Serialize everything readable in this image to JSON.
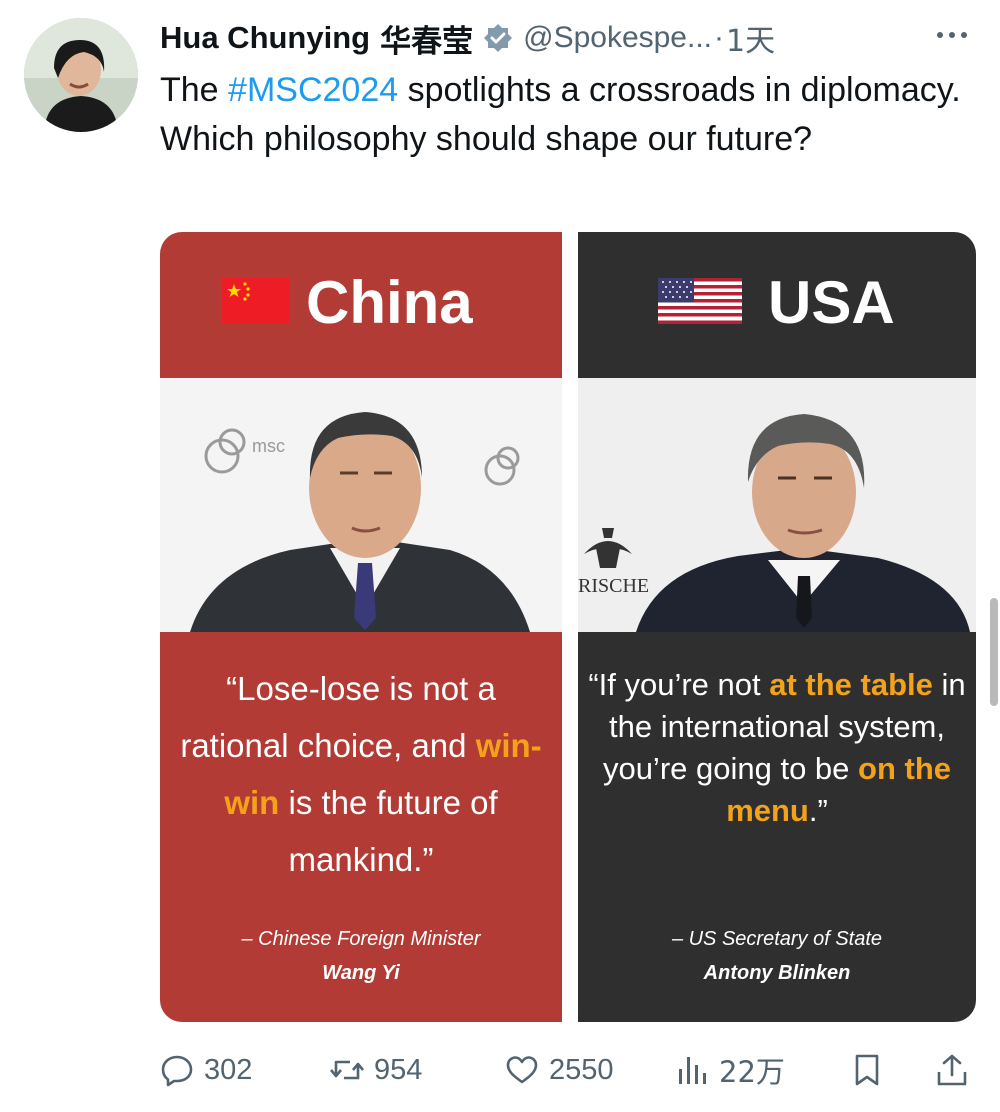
{
  "tweet": {
    "author_name": "Hua Chunying",
    "author_name_cn": "华春莹",
    "handle": "@Spokespe...",
    "separator": "·",
    "time": "1天",
    "text_before": "The ",
    "hashtag": "#MSC2024",
    "text_after": " spotlights a crossroads in diplomacy. Which philosophy should shape our future?"
  },
  "media": {
    "china": {
      "title": "China",
      "quote_open": "“Lose-lose is not a rational choice, and ",
      "quote_highlight": "win-win",
      "quote_close": " is the future of mankind.”",
      "attrib_role": "– Chinese Foreign Minister",
      "attrib_name": "Wang Yi",
      "panel_color": "#b23b35"
    },
    "usa": {
      "title": "USA",
      "quote_open": "“If you’re not ",
      "quote_highlight1": "at the table",
      "quote_mid": " in the international system, you’re going to be ",
      "quote_highlight2": "on the menu",
      "quote_close": ".”",
      "attrib_role": "– US Secretary of State",
      "attrib_name": "Antony Blinken",
      "panel_color": "#2f2f2f"
    },
    "highlight_color": "#f5a21b",
    "photo_text_china_logo": "msc",
    "photo_text_usa_sign": "RISCHE"
  },
  "actions": {
    "reply_count": "302",
    "retweet_count": "954",
    "like_count": "2550",
    "views_count": "22万"
  },
  "colors": {
    "hashtag": "#1d9bf0",
    "secondary_text": "#536471"
  }
}
